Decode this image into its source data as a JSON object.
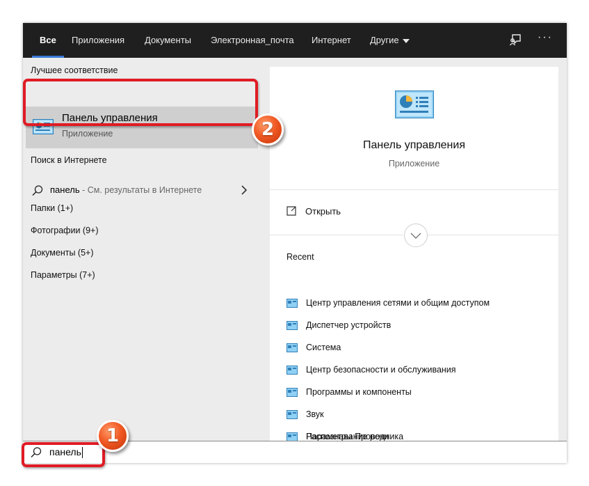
{
  "tabs": [
    {
      "label": "Все"
    },
    {
      "label": "Приложения"
    },
    {
      "label": "Документы"
    },
    {
      "label": "Электронная_почта"
    },
    {
      "label": "Интернет"
    },
    {
      "label": "Другие"
    }
  ],
  "icons": {
    "feedback": "feedback-icon",
    "more": "more-options-icon",
    "search": "search-icon",
    "control_panel": "control-panel-icon",
    "open": "open-icon",
    "expand": "chevron-down-icon",
    "chevron_right": "chevron-right-icon"
  },
  "top_more": "···",
  "left": {
    "best_match_label": "Лучшее соответствие",
    "best_match": {
      "title": "Панель управления",
      "subtitle": "Приложение"
    },
    "web_label": "Поиск в Интернете",
    "web_term": "панель",
    "web_hint": " - См. результаты в Интернете",
    "categories": [
      "Папки (1+)",
      "Фотографии (9+)",
      "Документы (5+)",
      "Параметры (7+)"
    ]
  },
  "right": {
    "title": "Панель управления",
    "subtitle": "Приложение",
    "open_label": "Открыть",
    "recent_label": "Recent",
    "recent": [
      "Центр управления сетями и общим доступом",
      "Диспетчер устройств",
      "Система",
      "Центр безопасности и обслуживания",
      "Программы и компоненты",
      "Звук",
      "Распознавание речи",
      "Параметры Проводника"
    ]
  },
  "search": {
    "value": "панель"
  },
  "badges": {
    "one": "1",
    "two": "2"
  },
  "colors": {
    "accent": "#3a7bd5",
    "annotation_red": "#e01b24",
    "badge_orange": "#f15a24",
    "topbar": "#1f1f1f"
  }
}
